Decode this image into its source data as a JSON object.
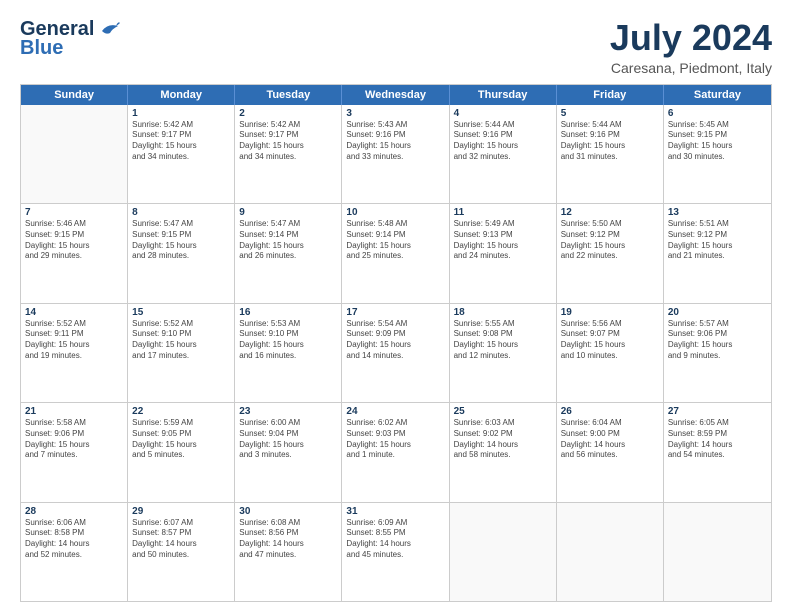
{
  "header": {
    "logo_line1": "General",
    "logo_line2": "Blue",
    "month_title": "July 2024",
    "location": "Caresana, Piedmont, Italy"
  },
  "calendar": {
    "days_of_week": [
      "Sunday",
      "Monday",
      "Tuesday",
      "Wednesday",
      "Thursday",
      "Friday",
      "Saturday"
    ],
    "rows": [
      [
        {
          "day": "",
          "lines": []
        },
        {
          "day": "1",
          "lines": [
            "Sunrise: 5:42 AM",
            "Sunset: 9:17 PM",
            "Daylight: 15 hours",
            "and 34 minutes."
          ]
        },
        {
          "day": "2",
          "lines": [
            "Sunrise: 5:42 AM",
            "Sunset: 9:17 PM",
            "Daylight: 15 hours",
            "and 34 minutes."
          ]
        },
        {
          "day": "3",
          "lines": [
            "Sunrise: 5:43 AM",
            "Sunset: 9:16 PM",
            "Daylight: 15 hours",
            "and 33 minutes."
          ]
        },
        {
          "day": "4",
          "lines": [
            "Sunrise: 5:44 AM",
            "Sunset: 9:16 PM",
            "Daylight: 15 hours",
            "and 32 minutes."
          ]
        },
        {
          "day": "5",
          "lines": [
            "Sunrise: 5:44 AM",
            "Sunset: 9:16 PM",
            "Daylight: 15 hours",
            "and 31 minutes."
          ]
        },
        {
          "day": "6",
          "lines": [
            "Sunrise: 5:45 AM",
            "Sunset: 9:15 PM",
            "Daylight: 15 hours",
            "and 30 minutes."
          ]
        }
      ],
      [
        {
          "day": "7",
          "lines": [
            "Sunrise: 5:46 AM",
            "Sunset: 9:15 PM",
            "Daylight: 15 hours",
            "and 29 minutes."
          ]
        },
        {
          "day": "8",
          "lines": [
            "Sunrise: 5:47 AM",
            "Sunset: 9:15 PM",
            "Daylight: 15 hours",
            "and 28 minutes."
          ]
        },
        {
          "day": "9",
          "lines": [
            "Sunrise: 5:47 AM",
            "Sunset: 9:14 PM",
            "Daylight: 15 hours",
            "and 26 minutes."
          ]
        },
        {
          "day": "10",
          "lines": [
            "Sunrise: 5:48 AM",
            "Sunset: 9:14 PM",
            "Daylight: 15 hours",
            "and 25 minutes."
          ]
        },
        {
          "day": "11",
          "lines": [
            "Sunrise: 5:49 AM",
            "Sunset: 9:13 PM",
            "Daylight: 15 hours",
            "and 24 minutes."
          ]
        },
        {
          "day": "12",
          "lines": [
            "Sunrise: 5:50 AM",
            "Sunset: 9:12 PM",
            "Daylight: 15 hours",
            "and 22 minutes."
          ]
        },
        {
          "day": "13",
          "lines": [
            "Sunrise: 5:51 AM",
            "Sunset: 9:12 PM",
            "Daylight: 15 hours",
            "and 21 minutes."
          ]
        }
      ],
      [
        {
          "day": "14",
          "lines": [
            "Sunrise: 5:52 AM",
            "Sunset: 9:11 PM",
            "Daylight: 15 hours",
            "and 19 minutes."
          ]
        },
        {
          "day": "15",
          "lines": [
            "Sunrise: 5:52 AM",
            "Sunset: 9:10 PM",
            "Daylight: 15 hours",
            "and 17 minutes."
          ]
        },
        {
          "day": "16",
          "lines": [
            "Sunrise: 5:53 AM",
            "Sunset: 9:10 PM",
            "Daylight: 15 hours",
            "and 16 minutes."
          ]
        },
        {
          "day": "17",
          "lines": [
            "Sunrise: 5:54 AM",
            "Sunset: 9:09 PM",
            "Daylight: 15 hours",
            "and 14 minutes."
          ]
        },
        {
          "day": "18",
          "lines": [
            "Sunrise: 5:55 AM",
            "Sunset: 9:08 PM",
            "Daylight: 15 hours",
            "and 12 minutes."
          ]
        },
        {
          "day": "19",
          "lines": [
            "Sunrise: 5:56 AM",
            "Sunset: 9:07 PM",
            "Daylight: 15 hours",
            "and 10 minutes."
          ]
        },
        {
          "day": "20",
          "lines": [
            "Sunrise: 5:57 AM",
            "Sunset: 9:06 PM",
            "Daylight: 15 hours",
            "and 9 minutes."
          ]
        }
      ],
      [
        {
          "day": "21",
          "lines": [
            "Sunrise: 5:58 AM",
            "Sunset: 9:06 PM",
            "Daylight: 15 hours",
            "and 7 minutes."
          ]
        },
        {
          "day": "22",
          "lines": [
            "Sunrise: 5:59 AM",
            "Sunset: 9:05 PM",
            "Daylight: 15 hours",
            "and 5 minutes."
          ]
        },
        {
          "day": "23",
          "lines": [
            "Sunrise: 6:00 AM",
            "Sunset: 9:04 PM",
            "Daylight: 15 hours",
            "and 3 minutes."
          ]
        },
        {
          "day": "24",
          "lines": [
            "Sunrise: 6:02 AM",
            "Sunset: 9:03 PM",
            "Daylight: 15 hours",
            "and 1 minute."
          ]
        },
        {
          "day": "25",
          "lines": [
            "Sunrise: 6:03 AM",
            "Sunset: 9:02 PM",
            "Daylight: 14 hours",
            "and 58 minutes."
          ]
        },
        {
          "day": "26",
          "lines": [
            "Sunrise: 6:04 AM",
            "Sunset: 9:00 PM",
            "Daylight: 14 hours",
            "and 56 minutes."
          ]
        },
        {
          "day": "27",
          "lines": [
            "Sunrise: 6:05 AM",
            "Sunset: 8:59 PM",
            "Daylight: 14 hours",
            "and 54 minutes."
          ]
        }
      ],
      [
        {
          "day": "28",
          "lines": [
            "Sunrise: 6:06 AM",
            "Sunset: 8:58 PM",
            "Daylight: 14 hours",
            "and 52 minutes."
          ]
        },
        {
          "day": "29",
          "lines": [
            "Sunrise: 6:07 AM",
            "Sunset: 8:57 PM",
            "Daylight: 14 hours",
            "and 50 minutes."
          ]
        },
        {
          "day": "30",
          "lines": [
            "Sunrise: 6:08 AM",
            "Sunset: 8:56 PM",
            "Daylight: 14 hours",
            "and 47 minutes."
          ]
        },
        {
          "day": "31",
          "lines": [
            "Sunrise: 6:09 AM",
            "Sunset: 8:55 PM",
            "Daylight: 14 hours",
            "and 45 minutes."
          ]
        },
        {
          "day": "",
          "lines": []
        },
        {
          "day": "",
          "lines": []
        },
        {
          "day": "",
          "lines": []
        }
      ]
    ]
  }
}
